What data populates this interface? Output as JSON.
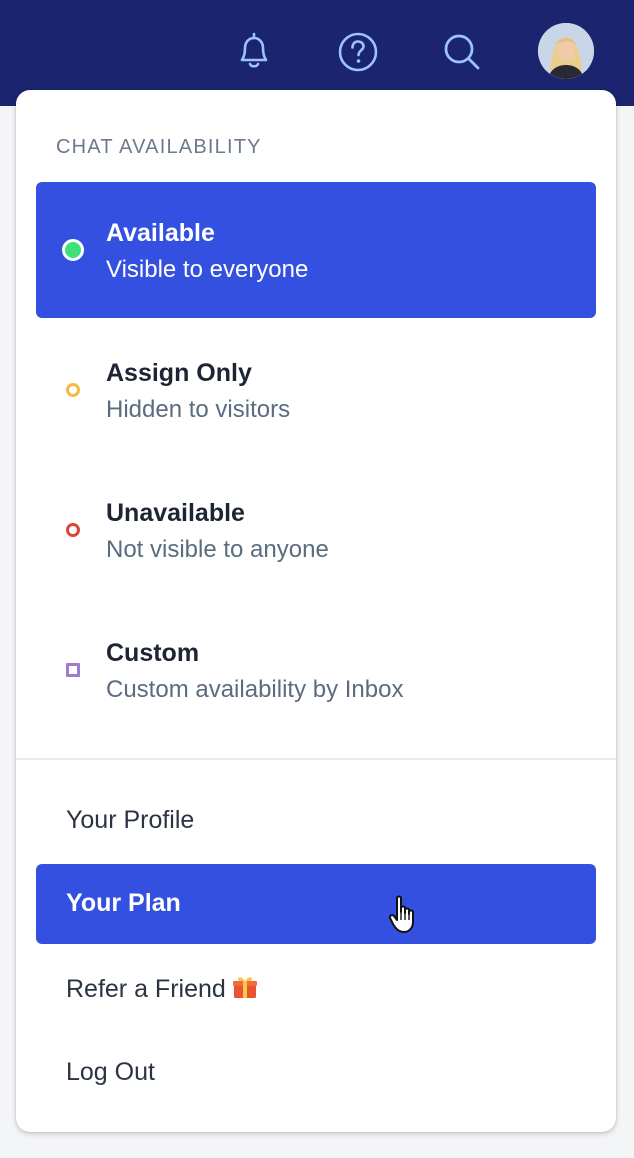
{
  "header": {
    "icons": [
      "bell-icon",
      "help-icon",
      "search-icon"
    ],
    "avatar_alt": "user-avatar"
  },
  "availability": {
    "section_title": "CHAT AVAILABILITY",
    "options": [
      {
        "label": "Available",
        "sub": "Visible to everyone",
        "selected": true,
        "dot_color": "#3ee07a",
        "dot_shape": "filled-circle"
      },
      {
        "label": "Assign Only",
        "sub": "Hidden to visitors",
        "selected": false,
        "dot_color": "#f5b942",
        "dot_shape": "ring"
      },
      {
        "label": "Unavailable",
        "sub": "Not visible to anyone",
        "selected": false,
        "dot_color": "#e0443a",
        "dot_shape": "ring"
      },
      {
        "label": "Custom",
        "sub": "Custom availability by Inbox",
        "selected": false,
        "dot_color": "#a07ad0",
        "dot_shape": "square"
      }
    ]
  },
  "account_menu": {
    "items": [
      {
        "label": "Your Profile",
        "selected": false
      },
      {
        "label": "Your Plan",
        "selected": true
      },
      {
        "label": "Refer a Friend",
        "selected": false,
        "icon": "gift-icon"
      },
      {
        "label": "Log Out",
        "selected": false
      }
    ]
  },
  "colors": {
    "header_bg": "#1b246e",
    "accent": "#3350e0",
    "icon_stroke": "#9cc3ff"
  }
}
